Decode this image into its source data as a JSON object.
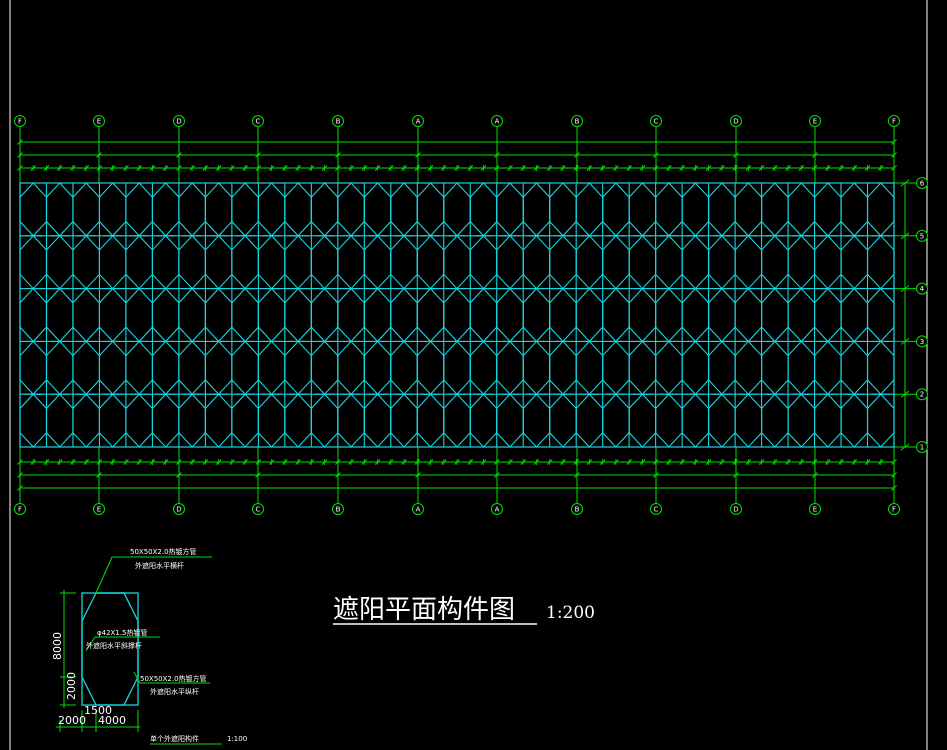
{
  "title": "遮阳平面构件图",
  "scale": "1:200",
  "colors": {
    "background": "#000000",
    "structure": "#17d6de",
    "grid": "#00e000",
    "text": "#ffffff"
  },
  "column_axes": [
    "F",
    "E",
    "D",
    "C",
    "B",
    "A",
    "A",
    "B",
    "C",
    "D",
    "E",
    "F"
  ],
  "row_axes": [
    "6",
    "5",
    "4",
    "3",
    "2",
    "1"
  ],
  "detail": {
    "caption": "单个外遮阳构件",
    "caption_scale": "1:100",
    "label_top_spec": "50X50X2.0热镀方管",
    "label_top_name": "外遮阳水平横杆",
    "label_mid_spec": "φ42X1.5热镀管",
    "label_mid_name": "外遮阳水平斜撑杆",
    "label_bot_spec": "50X50X2.0热镀方管",
    "label_bot_name": "外遮阳水平纵杆",
    "dim_height": "8000",
    "dim_lower": "2000",
    "dim_w_left": "2000",
    "dim_w_inner": "1500",
    "dim_w_total": "4000"
  }
}
